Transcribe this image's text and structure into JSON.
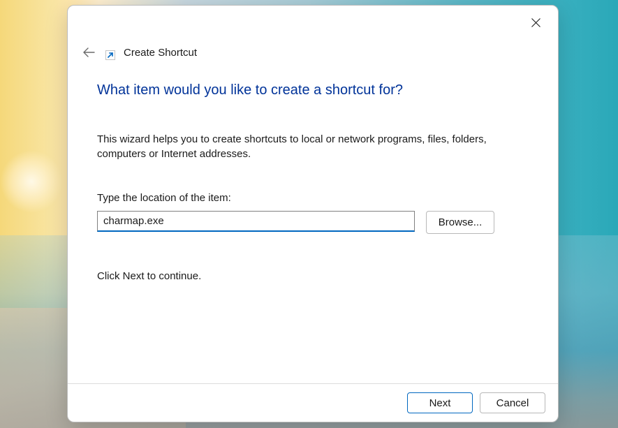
{
  "dialog": {
    "title": "Create Shortcut",
    "heading": "What item would you like to create a shortcut for?",
    "description": "This wizard helps you to create shortcuts to local or network programs, files, folders, computers or Internet addresses.",
    "location_label": "Type the location of the item:",
    "location_value": "charmap.exe",
    "browse_label": "Browse...",
    "continue_text": "Click Next to continue.",
    "next_label": "Next",
    "cancel_label": "Cancel"
  }
}
